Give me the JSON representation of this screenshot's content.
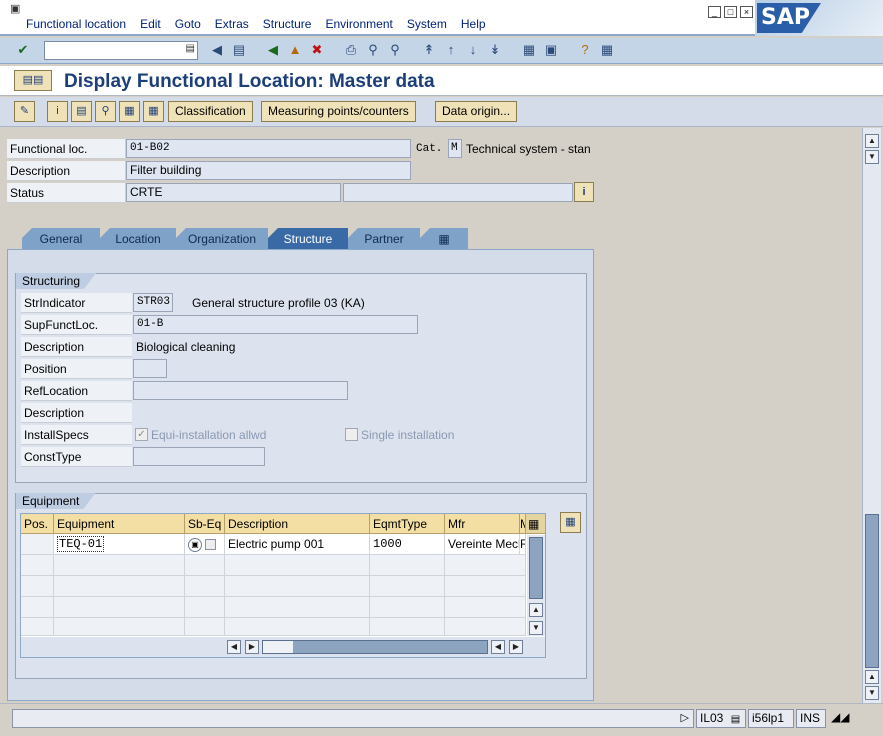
{
  "menu": {
    "items": [
      "Functional location",
      "Edit",
      "Goto",
      "Extras",
      "Structure",
      "Environment",
      "System",
      "Help"
    ],
    "logo": "SAP"
  },
  "toolbar": {
    "command_placeholder": ""
  },
  "title": "Display Functional Location: Master data",
  "app_toolbar": {
    "classification": "Classification",
    "measuring": "Measuring points/counters",
    "data_origin": "Data origin..."
  },
  "header": {
    "functional_loc_label": "Functional loc.",
    "functional_loc_value": "01-B02",
    "cat_label": "Cat.",
    "cat_value": "M",
    "cat_text": "Technical system - stan",
    "description_label": "Description",
    "description_value": "Filter building",
    "status_label": "Status",
    "status_value": "CRTE"
  },
  "tabs": [
    "General",
    "Location",
    "Organization",
    "Structure",
    "Partner"
  ],
  "active_tab": "Structure",
  "structuring": {
    "title": "Structuring",
    "strindicator_label": "StrIndicator",
    "strindicator_value": "STR03",
    "strindicator_text": "General structure profile 03 (KA)",
    "supfunctloc_label": "SupFunctLoc.",
    "supfunctloc_value": "01-B",
    "description_label": "Description",
    "description_value": "Biological cleaning",
    "position_label": "Position",
    "reflocation_label": "RefLocation",
    "description2_label": "Description",
    "installspecs_label": "InstallSpecs",
    "equi_install": "Equi-installation allwd",
    "single_install": "Single installation",
    "consttype_label": "ConstType"
  },
  "equipment": {
    "title": "Equipment",
    "columns": [
      "Pos.",
      "Equipment",
      "Sb-Eq",
      "Description",
      "EqmtType",
      "Mfr",
      "M"
    ],
    "rows": [
      {
        "pos": "",
        "equipment": "TEQ-01",
        "description": "Electric pump 001",
        "eqmttype": "1000",
        "mfr": "Vereinte Mech",
        "m": "F"
      }
    ]
  },
  "status": {
    "tcode": "IL03",
    "server": "i56lp1",
    "mode": "INS"
  }
}
